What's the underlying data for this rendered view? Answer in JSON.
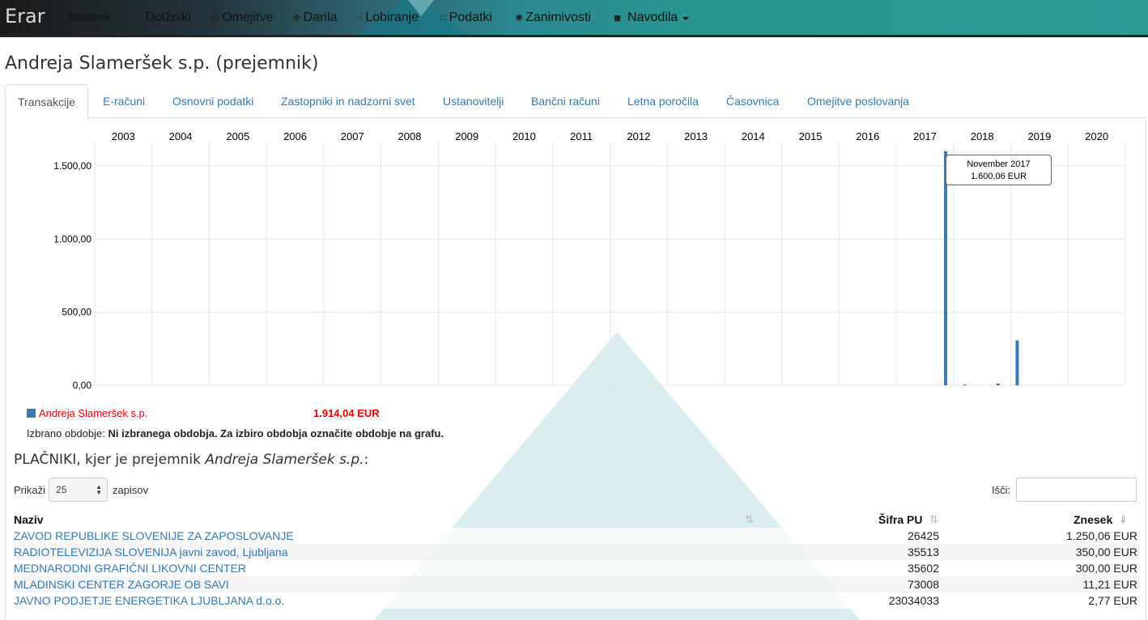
{
  "brand": "Erar",
  "nav": [
    {
      "label": "Iskalnik",
      "icon": "search-icon",
      "glyph": "⌕"
    },
    {
      "label": "Dolžniki",
      "icon": "fire-icon",
      "glyph": "♨"
    },
    {
      "label": "Omejitve",
      "icon": "briefcase-icon",
      "glyph": "▤"
    },
    {
      "label": "Darila",
      "icon": "gift-icon",
      "glyph": "❖"
    },
    {
      "label": "Lobiranje",
      "icon": "hand-icon",
      "glyph": "☝"
    },
    {
      "label": "Podatki",
      "icon": "grid-icon",
      "glyph": "∷"
    },
    {
      "label": "Zanimivosti",
      "icon": "asterisk-icon",
      "glyph": "✺"
    },
    {
      "label": "Navodila",
      "icon": "book-icon",
      "glyph": "■"
    }
  ],
  "page_title": "Andreja Slameršek s.p. (prejemnik)",
  "tabs": [
    {
      "label": "Transakcije",
      "active": true
    },
    {
      "label": "E-računi"
    },
    {
      "label": "Osnovni podatki"
    },
    {
      "label": "Zastopniki in nadzorni svet"
    },
    {
      "label": "Ustanovitelji"
    },
    {
      "label": "Bančni računi"
    },
    {
      "label": "Letna poročila"
    },
    {
      "label": "Časovnica"
    },
    {
      "label": "Omejitve poslovanja"
    }
  ],
  "chart_data": {
    "type": "bar",
    "x_axis": [
      "2003",
      "2004",
      "2005",
      "2006",
      "2007",
      "2008",
      "2009",
      "2010",
      "2011",
      "2012",
      "2013",
      "2014",
      "2015",
      "2016",
      "2017",
      "2018",
      "2019",
      "2020"
    ],
    "y_ticks": [
      "0,00",
      "500,00",
      "1.000,00",
      "1.500,00"
    ],
    "ylim": [
      0,
      1660
    ],
    "series": [
      {
        "name": "Andreja Slameršek s.p.",
        "color": "#3a7ab6",
        "points": [
          {
            "period": "November 2017",
            "value": 1600.06
          },
          {
            "period": "2018-03",
            "value": 5
          },
          {
            "period": "2018-10",
            "value": 12
          },
          {
            "period": "2019-02",
            "value": 307
          }
        ]
      }
    ],
    "tooltip": {
      "period": "November 2017",
      "amount": "1.600,06 EUR"
    }
  },
  "legend": {
    "name": "Andreja Slameršek s.p.",
    "total": "1.914,04 EUR"
  },
  "period_label": "Izbrano obdobje:",
  "period_value": "Ni izbranega obdobja. Za izbiro obdobja označite obdobje na grafu.",
  "section": {
    "prefix": "PLAČNIKI, kjer je prejemnik ",
    "name": "Andreja Slameršek s.p.",
    "suffix": ":"
  },
  "length": {
    "before": "Prikaži",
    "value": "25",
    "after": "zapisov"
  },
  "search": {
    "label": "Išči:",
    "value": ""
  },
  "table": {
    "headers": {
      "name": "Naziv",
      "code": "Šifra PU",
      "amount": "Znesek"
    },
    "rows": [
      {
        "name": "ZAVOD REPUBLIKE SLOVENIJE ZA ZAPOSLOVANJE",
        "code": "26425",
        "amount": "1.250,06 EUR"
      },
      {
        "name": "RADIOTELEVIZIJA SLOVENIJA javni zavod, Ljubljana",
        "code": "35513",
        "amount": "350,00 EUR"
      },
      {
        "name": "MEDNARODNI GRAFIČNI LIKOVNI CENTER",
        "code": "35602",
        "amount": "300,00 EUR"
      },
      {
        "name": "MLADINSKI CENTER ZAGORJE OB SAVI",
        "code": "73008",
        "amount": "11,21 EUR"
      },
      {
        "name": "JAVNO PODJETJE ENERGETIKA LJUBLJANA d.o.o.",
        "code": "23034033",
        "amount": "2,77 EUR"
      }
    ]
  }
}
